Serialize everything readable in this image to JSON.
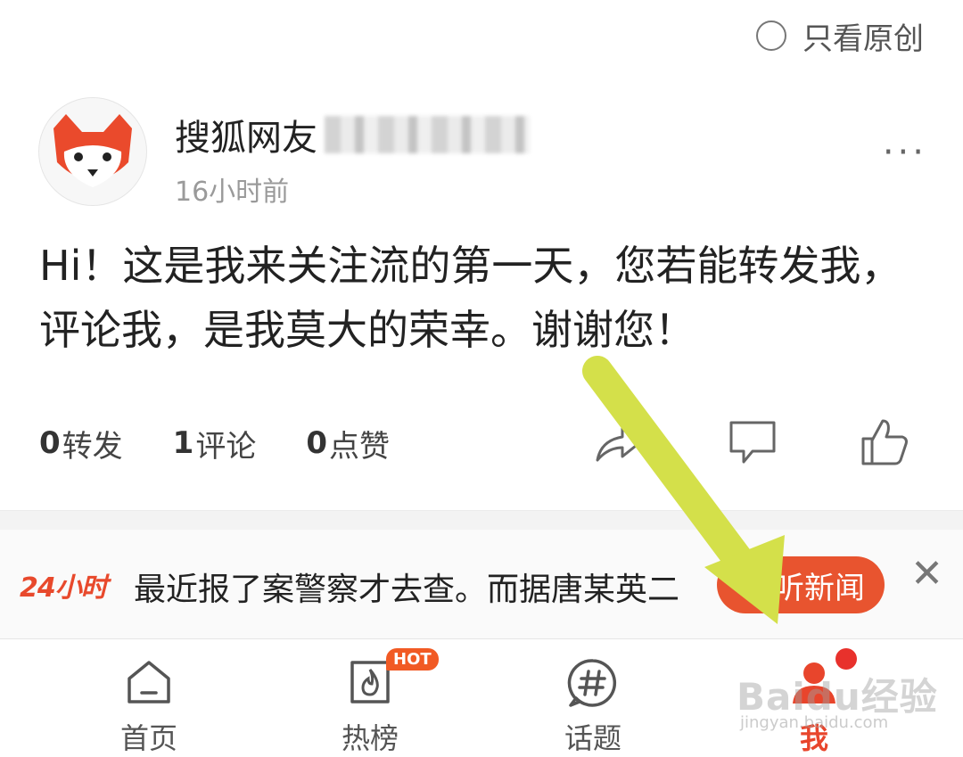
{
  "filter": {
    "label": "只看原创",
    "checked": false
  },
  "post": {
    "author_visible": "搜狐网友",
    "time": "16小时前",
    "text": "Hi！这是我来关注流的第一天，您若能转发我，评论我，是我莫大的荣幸。谢谢您！",
    "more_icon": "more-dots-icon",
    "stats": [
      {
        "count": "0",
        "label": "转发"
      },
      {
        "count": "1",
        "label": "评论"
      },
      {
        "count": "0",
        "label": "点赞"
      }
    ],
    "actions": [
      "share-icon",
      "comment-icon",
      "like-icon"
    ]
  },
  "banner": {
    "logo": "24小时",
    "ticker": "最近报了案警察才去查。而据唐某英二",
    "button": "听新闻",
    "close_icon": "close-icon"
  },
  "tabs": [
    {
      "label": "首页",
      "icon": "home-icon"
    },
    {
      "label": "热榜",
      "icon": "fire-icon",
      "badge": "HOT"
    },
    {
      "label": "话题",
      "icon": "hashtag-icon"
    },
    {
      "label": "我",
      "icon": "profile-icon",
      "active": true,
      "dot": true
    }
  ],
  "watermark": {
    "text": "Baidu经验",
    "sub": "jingyan.baidu.com"
  },
  "colors": {
    "accent": "#e8542f",
    "arrow": "#d4e04a",
    "text": "#222222",
    "muted": "#9a9a9a"
  }
}
